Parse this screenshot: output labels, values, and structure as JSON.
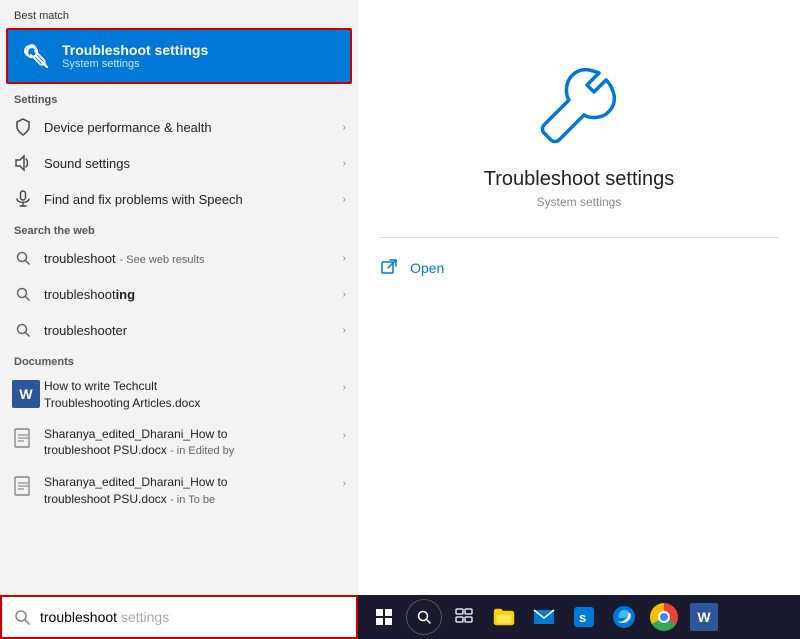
{
  "leftPanel": {
    "bestMatch": {
      "label": "Best match",
      "title": "Troubleshoot settings",
      "subtitle": "System settings"
    },
    "settingsSection": {
      "header": "Settings",
      "items": [
        {
          "icon": "shield",
          "label": "Device performance & health",
          "id": "device-perf"
        },
        {
          "icon": "sound",
          "label": "Sound settings",
          "id": "sound-settings"
        },
        {
          "icon": "mic",
          "label": "Find and fix problems with Speech",
          "id": "speech"
        }
      ]
    },
    "webSection": {
      "header": "Search the web",
      "items": [
        {
          "label": "troubleshoot",
          "sub": "- See web results",
          "id": "web-troubleshoot",
          "bold": false
        },
        {
          "label": "troubleshoot",
          "labelBold": "ing",
          "sub": "",
          "id": "web-troubleshooting",
          "bold": true
        },
        {
          "label": "troubleshooter",
          "sub": "",
          "id": "web-troubleshooter",
          "bold": false
        }
      ]
    },
    "documentsSection": {
      "header": "Documents",
      "items": [
        {
          "line1": "How to write Techcult",
          "line1Bold": "",
          "line2": "Troubleshoot",
          "line2Bold": "ing Articles.docx",
          "id": "doc1"
        },
        {
          "line1": "Sharanya_edited_Dharani_How to",
          "line2Bold": "troubleshoot",
          "line2": " PSU.docx",
          "sub": "- in Edited by",
          "id": "doc2"
        },
        {
          "line1": "Sharanya_edited_Dharani_How to",
          "line2Bold": "troubleshoot",
          "line2": " PSU.docx",
          "sub": "- in To be",
          "id": "doc3"
        }
      ]
    }
  },
  "searchBar": {
    "typed": "troubleshoot",
    "suggestion": " settings"
  },
  "rightPanel": {
    "title": "Troubleshoot settings",
    "subtitle": "System settings",
    "openLabel": "Open"
  },
  "taskbar": {
    "searchCircle": "○",
    "buttons": [
      "⊞",
      "⊟",
      "📁",
      "✉",
      "🌐",
      "e",
      "W"
    ]
  }
}
